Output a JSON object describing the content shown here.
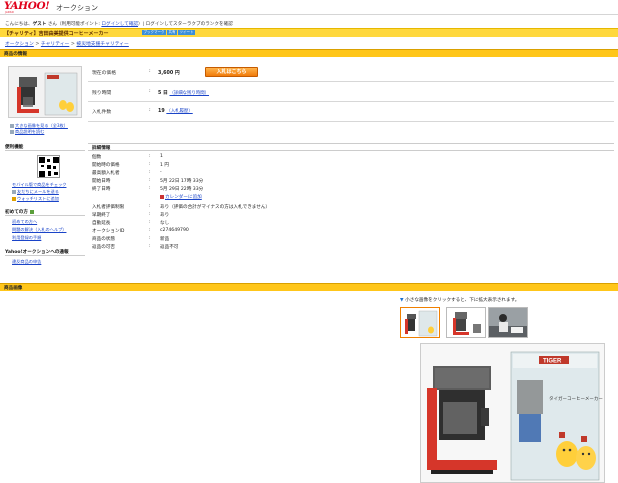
{
  "header": {
    "logo": "YAHOO!",
    "logo_sub": "JAPAN",
    "site_name": "オークション"
  },
  "greeting": {
    "prefix": "こんにちは、",
    "user": "ゲスト",
    "middle": " さん（利用可能ポイント: ",
    "login_link": "ログインして確認",
    "rest": "）| ログインしてスターラクブのランクを確認"
  },
  "item_title": "【チャリティ】吉田由美提供コーヒーメーカー",
  "title_buttons": [
    "ブックマーク",
    "共有",
    "ツイート"
  ],
  "breadcrumb": [
    "オークション",
    "チャリティー",
    "被災地支援チャリティー"
  ],
  "sections": {
    "product_info": "商品の情報",
    "product_images": "商品画像"
  },
  "product": {
    "current_price_label": "現在の価格",
    "current_price": "3,600 円",
    "bid_button": "入札はこちら",
    "time_left_label": "残り時間",
    "time_left": "5 日",
    "time_left_link": "（詳細な残り時間）",
    "bids_label": "入札件数",
    "bids": "19",
    "bids_link": "（入札履歴）",
    "image_links": [
      "大きな画像を見る（全3枚）",
      "商品説明を読む"
    ]
  },
  "sidebar": {
    "convenience_title": "便利機能",
    "mobile_links": [
      "モバイル版で商品をチェック",
      "友だちにメールを送る",
      "ウォッチリストに追加"
    ],
    "help_title": "初めての方 ",
    "help_links": [
      "初めての方へ",
      "問題の解決（入札のヘルプ）",
      "利用登録の手順"
    ],
    "report_title": "Yahoo!オークションへの通報",
    "report_link": "違反商品の申告"
  },
  "details": {
    "title": "詳細情報",
    "rows": [
      {
        "label": "個数",
        "value": "1"
      },
      {
        "label": "開始時の価格",
        "value": "1 円"
      },
      {
        "label": "最高額入札者",
        "value": "-"
      },
      {
        "label": "開始日時",
        "value": "5月 22日 17時 33分"
      },
      {
        "label": "終了日時",
        "value": "5月 29日 22時 33分"
      },
      {
        "label": "",
        "value": "カレンダーに追加"
      },
      {
        "label": "入札者評価制限",
        "value": "あり（評価の合計がマイナスの方は入札できません）"
      },
      {
        "label": "早期終了",
        "value": "あり"
      },
      {
        "label": "自動延長",
        "value": "なし"
      },
      {
        "label": "オークションID",
        "value": "c274649790"
      },
      {
        "label": "商品の状態",
        "value": "新品"
      },
      {
        "label": "返品の可否",
        "value": "返品不可"
      }
    ]
  },
  "images": {
    "note": "小さな画像をクリックすると、下に拡大表示されます。",
    "thumbs": [
      "coffee-maker-box",
      "coffee-maker-product",
      "signing-photo"
    ],
    "big_box_brand": "TIGER",
    "big_box_title": "タイガーコーヒーメーカー"
  },
  "colors": {
    "accent_yellow": "#ffc61a",
    "title_yellow": "#ffd83c",
    "link": "#1a44c8",
    "bid_orange": "#f07a0a",
    "yahoo_red": "#e0001a"
  }
}
